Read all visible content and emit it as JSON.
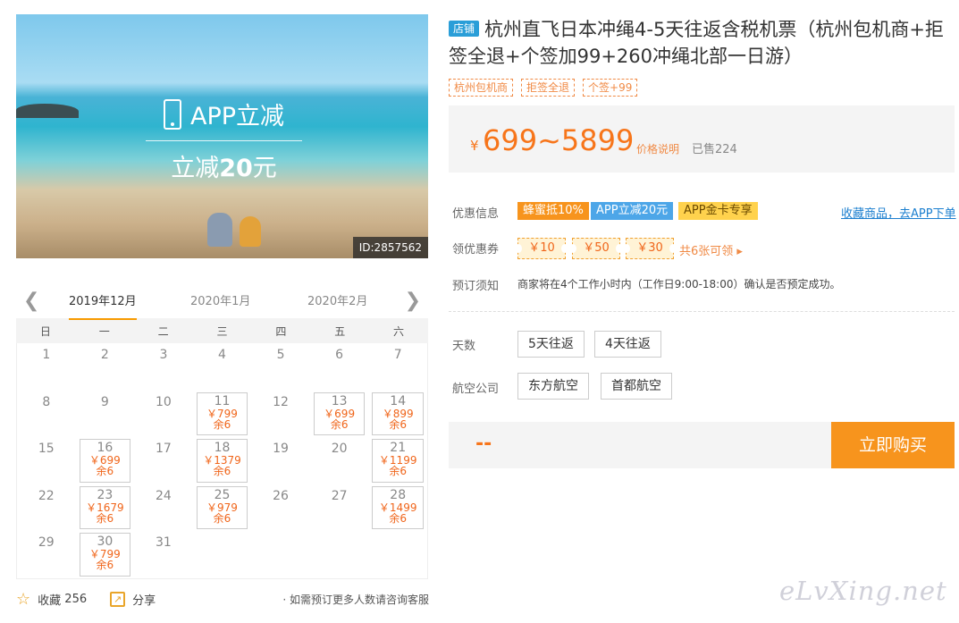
{
  "hero": {
    "promo_title": "APP立减",
    "promo_prefix": "立减",
    "promo_amount": "20",
    "promo_suffix": "元",
    "id_badge": "ID:2857562"
  },
  "calendar": {
    "months": [
      "2019年12月",
      "2020年1月",
      "2020年2月"
    ],
    "active_month_index": 0,
    "weekdays": [
      "日",
      "一",
      "二",
      "三",
      "四",
      "五",
      "六"
    ],
    "stock_label": "余6",
    "days": [
      {
        "d": "1"
      },
      {
        "d": "2"
      },
      {
        "d": "3"
      },
      {
        "d": "4"
      },
      {
        "d": "5"
      },
      {
        "d": "6"
      },
      {
        "d": "7"
      },
      {
        "d": "8"
      },
      {
        "d": "9"
      },
      {
        "d": "10"
      },
      {
        "d": "11",
        "price": "￥799"
      },
      {
        "d": "12"
      },
      {
        "d": "13",
        "price": "￥699"
      },
      {
        "d": "14",
        "price": "￥899"
      },
      {
        "d": "15"
      },
      {
        "d": "16",
        "price": "￥699"
      },
      {
        "d": "17"
      },
      {
        "d": "18",
        "price": "￥1379"
      },
      {
        "d": "19"
      },
      {
        "d": "20"
      },
      {
        "d": "21",
        "price": "￥1199"
      },
      {
        "d": "22"
      },
      {
        "d": "23",
        "price": "￥1679"
      },
      {
        "d": "24"
      },
      {
        "d": "25",
        "price": "￥979"
      },
      {
        "d": "26"
      },
      {
        "d": "27"
      },
      {
        "d": "28",
        "price": "￥1499"
      },
      {
        "d": "29"
      },
      {
        "d": "30",
        "price": "￥799"
      },
      {
        "d": "31"
      }
    ]
  },
  "footer": {
    "collect_label": "收藏",
    "collect_count": "256",
    "share_label": "分享",
    "note": "· 如需预订更多人数请咨询客服"
  },
  "product": {
    "shop_badge": "店铺",
    "title": "杭州直飞日本冲绳4-5天往返含税机票（杭州包机商+拒签全退+个签加99+260冲绳北部一日游）",
    "tags": [
      "杭州包机商",
      "拒签全退",
      "个签+99"
    ],
    "currency": "¥",
    "price_range": "699~5899",
    "price_explain": "价格说明",
    "sold": "已售224"
  },
  "promotions": {
    "label": "优惠信息",
    "badges": [
      "蜂蜜抵10%",
      "APP立减20元",
      "APP金卡专享"
    ],
    "fav_link": "收藏商品，去APP下单"
  },
  "coupons": {
    "label": "领优惠券",
    "items": [
      "￥10",
      "￥50",
      "￥30"
    ],
    "more": "共6张可领 ▸"
  },
  "booking_notice": {
    "label": "预订须知",
    "text": "商家将在4个工作小时内（工作日9:00-18:00）确认是否预定成功。"
  },
  "options": {
    "days_label": "天数",
    "days": [
      "5天往返",
      "4天往返"
    ],
    "airline_label": "航空公司",
    "airlines": [
      "东方航空",
      "首都航空"
    ]
  },
  "buy": {
    "total": "--",
    "button": "立即购买"
  },
  "watermark": "eLvXing.net"
}
